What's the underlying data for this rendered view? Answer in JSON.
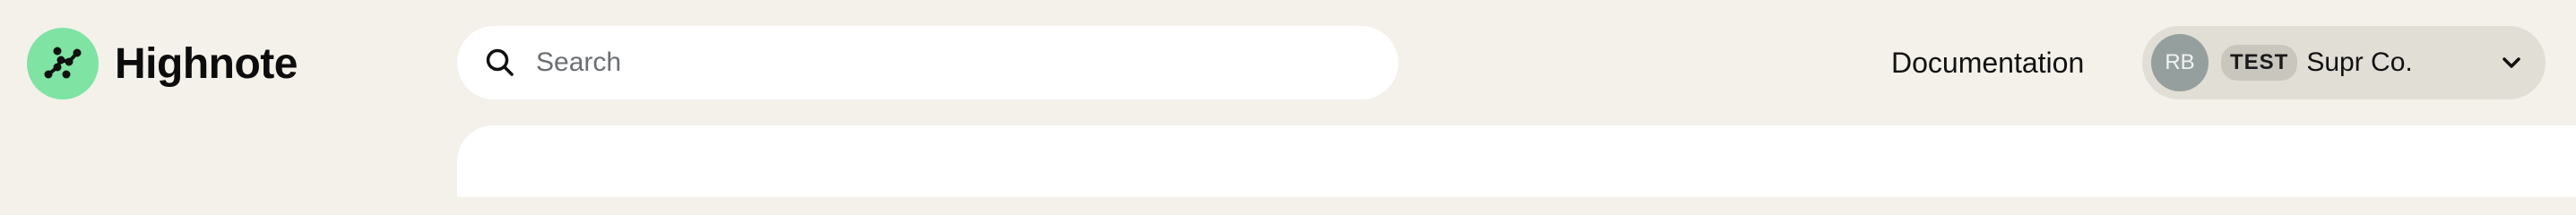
{
  "brand": {
    "name": "Highnote",
    "logo_color": "#7fe3a3"
  },
  "search": {
    "placeholder": "Search",
    "value": "",
    "icon": "search-icon"
  },
  "header": {
    "documentation_label": "Documentation"
  },
  "account": {
    "avatar_initials": "RB",
    "environment_badge": "TEST",
    "organization": "Supr Co.",
    "menu_icon": "chevron-down-icon"
  },
  "colors": {
    "background": "#f4f1ea",
    "surface": "#ffffff",
    "account_pill": "#e1ded6",
    "avatar": "#95a09e",
    "badge": "#c9c6be"
  }
}
